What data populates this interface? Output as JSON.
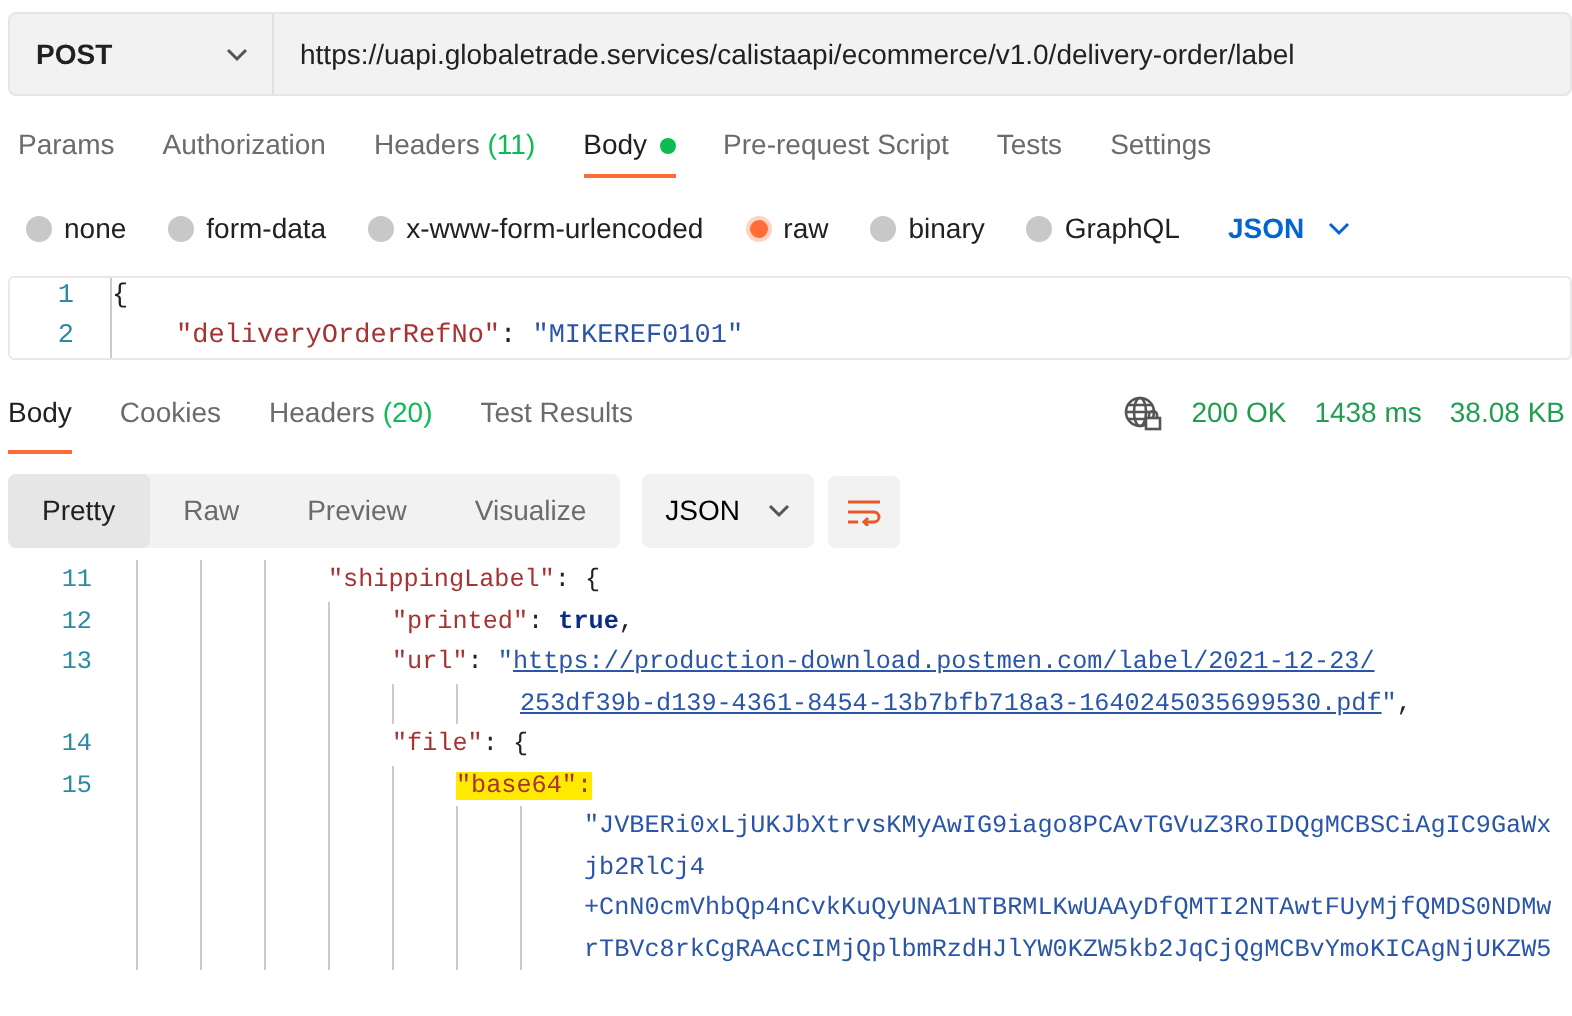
{
  "request": {
    "method": "POST",
    "url": "https://uapi.globaletrade.services/calistaapi/ecommerce/v1.0/delivery-order/label"
  },
  "request_tabs": [
    {
      "label": "Params",
      "selected": false
    },
    {
      "label": "Authorization",
      "selected": false
    },
    {
      "label": "Headers",
      "count": "(11)",
      "selected": false
    },
    {
      "label": "Body",
      "dot": true,
      "selected": true
    },
    {
      "label": "Pre-request Script",
      "selected": false
    },
    {
      "label": "Tests",
      "selected": false
    },
    {
      "label": "Settings",
      "selected": false
    }
  ],
  "body_types": [
    {
      "label": "none",
      "selected": false
    },
    {
      "label": "form-data",
      "selected": false
    },
    {
      "label": "x-www-form-urlencoded",
      "selected": false
    },
    {
      "label": "raw",
      "selected": true
    },
    {
      "label": "binary",
      "selected": false
    },
    {
      "label": "GraphQL",
      "selected": false
    }
  ],
  "body_format": "JSON",
  "editor_lines": [
    {
      "number": "1",
      "tokens": [
        {
          "kind": "punct",
          "text": "{"
        }
      ]
    },
    {
      "number": "2",
      "tokens": [
        {
          "kind": "key",
          "text": "\"deliveryOrderRefNo\""
        },
        {
          "kind": "punct",
          "text": ": "
        },
        {
          "kind": "string",
          "text": "\"MIKEREF0101\""
        }
      ]
    }
  ],
  "response_tabs": [
    {
      "label": "Body",
      "selected": true
    },
    {
      "label": "Cookies",
      "selected": false
    },
    {
      "label": "Headers",
      "count": "(20)",
      "selected": false
    },
    {
      "label": "Test Results",
      "selected": false
    }
  ],
  "response_status": {
    "status": "200 OK",
    "time": "1438 ms",
    "size": "38.08 KB"
  },
  "view_modes": [
    {
      "label": "Pretty",
      "selected": true
    },
    {
      "label": "Raw",
      "selected": false
    },
    {
      "label": "Preview",
      "selected": false
    },
    {
      "label": "Visualize",
      "selected": false
    }
  ],
  "response_format": "JSON",
  "response_lines": [
    {
      "number": "11",
      "tokens": [
        {
          "kind": "key",
          "text": "\"shippingLabel\""
        },
        {
          "kind": "punct",
          "text": ": {"
        }
      ],
      "children": [
        {
          "number": "12",
          "tokens": [
            {
              "kind": "key",
              "text": "\"printed\""
            },
            {
              "kind": "punct",
              "text": ": "
            },
            {
              "kind": "bool",
              "text": "true"
            },
            {
              "kind": "punct",
              "text": ","
            }
          ]
        },
        {
          "number": "13",
          "tokens": [
            {
              "kind": "key",
              "text": "\"url\""
            },
            {
              "kind": "punct",
              "text": ": "
            },
            {
              "kind": "string",
              "text": "\""
            },
            {
              "kind": "link",
              "text": "https://production-download.postmen.com/label/2021-12-23/"
            }
          ],
          "wrap_lines": [
            [
              {
                "kind": "link",
                "text": "253df39b-d139-4361-8454-13b7bfb718a3-1640245035699530.pdf"
              },
              {
                "kind": "string",
                "text": "\""
              },
              {
                "kind": "punct",
                "text": ","
              }
            ]
          ]
        },
        {
          "number": "14",
          "tokens": [
            {
              "kind": "key",
              "text": "\"file\""
            },
            {
              "kind": "punct",
              "text": ": {"
            }
          ],
          "children": [
            {
              "number": "15",
              "tokens": [
                {
                  "kind": "key",
                  "text": "\"base64\":",
                  "highlighted": true
                }
              ],
              "wrap_lines": [
                [
                  {
                    "kind": "string",
                    "text": "\"JVBERi0xLjUKJbXtrvsKMyAwIG9iago8PCAvTGVuZ3RoIDQgMCBSCiAgIC9GaWx"
                  }
                ],
                [
                  {
                    "kind": "string",
                    "text": "jb2RlCj4"
                  }
                ],
                [
                  {
                    "kind": "string",
                    "text": "+CnN0cmVhbQp4nCvkKuQyUNA1NTBRMLKwUAAyDfQMTI2NTAwtFUyMjfQMDS0NDMw"
                  }
                ],
                [
                  {
                    "kind": "string",
                    "text": "rTBVc8rkCgRAAcCIMjQplbmRzdHJlYW0KZW5kb2JqCjQgMCBvYmoKICAgNjUKZW5"
                  }
                ]
              ]
            }
          ]
        }
      ]
    }
  ]
}
